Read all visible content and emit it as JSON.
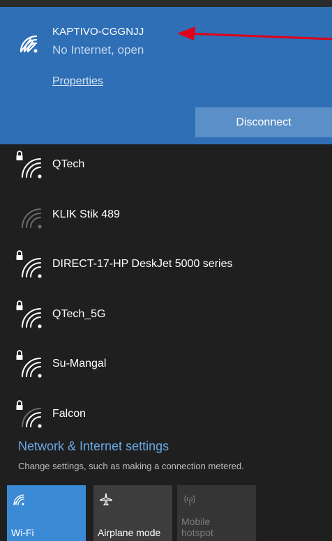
{
  "connected": {
    "name": "KAPTIVO-CGGNJJ",
    "status": "No Internet, open",
    "properties_label": "Properties",
    "disconnect_label": "Disconnect"
  },
  "networks": [
    {
      "name": "QTech",
      "secured": true,
      "strength": "strong"
    },
    {
      "name": "KLIK Stik 489",
      "secured": false,
      "strength": "weak"
    },
    {
      "name": "DIRECT-17-HP DeskJet 5000 series",
      "secured": true,
      "strength": "strong"
    },
    {
      "name": "QTech_5G",
      "secured": true,
      "strength": "strong"
    },
    {
      "name": "Su-Mangal",
      "secured": true,
      "strength": "strong"
    },
    {
      "name": "Falcon",
      "secured": true,
      "strength": "medium"
    }
  ],
  "settings": {
    "link_label": "Network & Internet settings",
    "description": "Change settings, such as making a connection metered."
  },
  "tiles": {
    "wifi": {
      "label": "Wi-Fi",
      "icon": "wifi-icon"
    },
    "airplane": {
      "label": "Airplane mode",
      "icon": "airplane-icon"
    },
    "hotspot": {
      "label_line1": "Mobile",
      "label_line2": "hotspot",
      "icon": "hotspot-icon"
    }
  },
  "colors": {
    "accent": "#2f6fb5",
    "background": "#1f1f1f",
    "annotation_arrow": "#e0001b"
  }
}
